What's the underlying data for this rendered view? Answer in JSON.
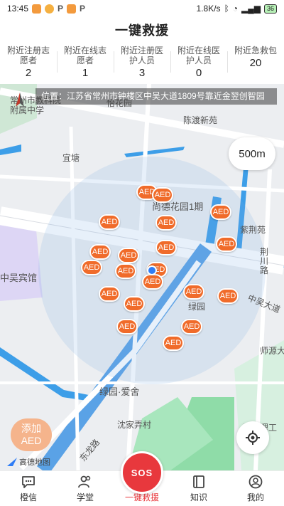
{
  "status_bar": {
    "time": "13:45",
    "net_speed": "1.8K/s",
    "battery": "36"
  },
  "title": "一键救援",
  "stats": [
    {
      "label": "附近注册志愿者",
      "value": "2"
    },
    {
      "label": "附近在线志愿者",
      "value": "1"
    },
    {
      "label": "附近注册医护人员",
      "value": "3"
    },
    {
      "label": "附近在线医护人员",
      "value": "0"
    },
    {
      "label": "附近急救包",
      "value": "20"
    }
  ],
  "map": {
    "location": "位置：江苏省常州市钟楼区中吴大道1809号靠近金翌创智园",
    "scale": "500m",
    "marker_label": "AED",
    "labels": [
      "常州市教科院附属中学",
      "怡花园",
      "陈渡新苑",
      "宜塘",
      "尚德花园1期",
      "紫荆苑",
      "荆川路",
      "中吴宾馆",
      "中吴大道",
      "绿园",
      "师源大",
      "绿园·爱舍",
      "沈家弄村",
      "东龙路",
      "江苏理工"
    ],
    "add_aed_line1": "添加",
    "add_aed_line2": "AED",
    "amap": "高德地图"
  },
  "nav": {
    "items": [
      "橙信",
      "学堂",
      "一键救援",
      "知识",
      "我的"
    ],
    "sos": "SOS"
  },
  "colors": {
    "accent": "#e8383d",
    "aed": "#f06b2a",
    "water": "#3d9ee8"
  }
}
